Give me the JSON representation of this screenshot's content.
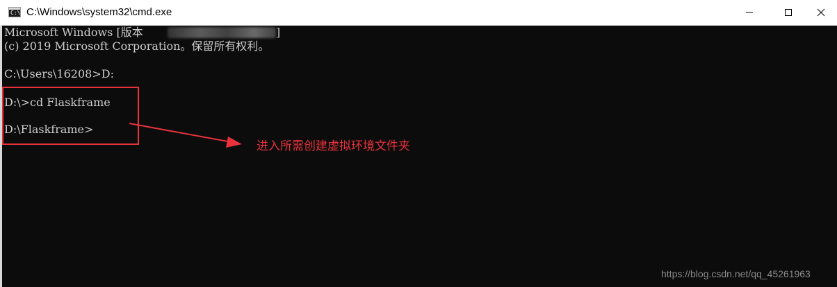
{
  "window": {
    "title": "C:\\Windows\\system32\\cmd.exe",
    "icon": "cmd-icon",
    "icon_text": "C:\\"
  },
  "console": {
    "lines": [
      "Microsoft Windows [版本",
      "(c) 2019 Microsoft Corporation。保留所有权利。",
      "",
      "C:\\Users\\16208>D:",
      "",
      "D:\\>cd Flaskframe",
      "",
      "D:\\Flaskframe>"
    ],
    "version_bracket_close": "]"
  },
  "annotation": {
    "text": "进入所需创建虚拟环境文件夹",
    "color": "#e8323c"
  },
  "watermark": {
    "text": "https://blog.csdn.net/qq_45261963"
  },
  "colors": {
    "console_bg": "#0c0c0c",
    "console_text": "#cccccc",
    "accent": "#e8323c"
  }
}
